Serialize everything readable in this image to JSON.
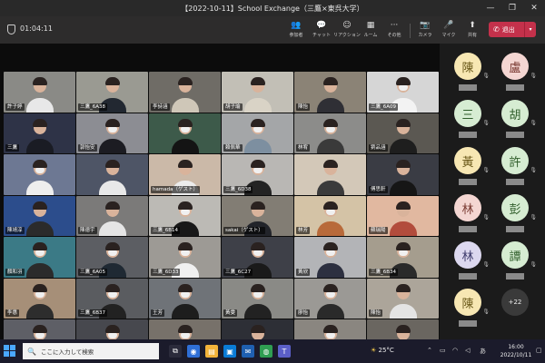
{
  "window": {
    "title": "【2022-10-11】School Exchange（三鷹×東呉大学）",
    "minimize": "—",
    "maximize": "❐",
    "close": "✕"
  },
  "toolbar": {
    "timer": "01:04:11",
    "items": [
      {
        "icon": "👥",
        "label": "参加者"
      },
      {
        "icon": "💬",
        "label": "チャット"
      },
      {
        "icon": "☺",
        "label": "リアクション"
      },
      {
        "icon": "▦",
        "label": "ルーム"
      },
      {
        "icon": "···",
        "label": "その他"
      },
      {
        "icon": "📷",
        "label": "カメラ"
      },
      {
        "icon": "🎤",
        "label": "マイク"
      },
      {
        "icon": "⬆",
        "label": "共有"
      }
    ],
    "leave_icon": "✆",
    "leave_label": "退出",
    "leave_dropdown": "▾"
  },
  "tiles": [
    {
      "name": "許子婷",
      "bg": "#8a8a86",
      "shirt": "#e8e8e8",
      "mask": false
    },
    {
      "name": "三鷹_6A38",
      "bg": "#9a9a92",
      "shirt": "#222831",
      "mask": false
    },
    {
      "name": "李詩涵",
      "bg": "#6f6c66",
      "shirt": "#cfc7b8",
      "mask": false
    },
    {
      "name": "胡子瑜",
      "bg": "#c2bfb6",
      "shirt": "#d9d3c6",
      "mask": false
    },
    {
      "name": "陳怡",
      "bg": "#8b8376",
      "shirt": "#2f2f35",
      "mask": false
    },
    {
      "name": "三鷹_6A09",
      "bg": "#d6d6d6",
      "shirt": "#f3f3f3",
      "mask": true
    },
    {
      "name": "三鷹",
      "bg": "#2e3347",
      "shirt": "#1a1c24",
      "mask": false
    },
    {
      "name": "郭怡安",
      "bg": "#8c8d93",
      "shirt": "#1c1c22",
      "mask": true
    },
    {
      "name": "",
      "bg": "#3d5a4a",
      "shirt": "#141414",
      "mask": true
    },
    {
      "name": "賴佩華",
      "bg": "#a4a6a8",
      "shirt": "#7d8fa0",
      "mask": true
    },
    {
      "name": "林宥",
      "bg": "#8c8c8a",
      "shirt": "#3a3a3a",
      "mask": true
    },
    {
      "name": "劉品涵",
      "bg": "#5b5852",
      "shirt": "#1e1e1e",
      "mask": false
    },
    {
      "name": "",
      "bg": "#6d7893",
      "shirt": "#eeeeee",
      "mask": true
    },
    {
      "name": "",
      "bg": "#4e5566",
      "shirt": "#e8e8e8",
      "mask": false
    },
    {
      "name": "hamada（ゲスト）",
      "bg": "#cbb9a8",
      "shirt": "#ececec",
      "mask": false
    },
    {
      "name": "三鷹_6D38",
      "bg": "#b9b7b4",
      "shirt": "#232323",
      "mask": true
    },
    {
      "name": "",
      "bg": "#d3c8b8",
      "shirt": "#3b3b3b",
      "mask": false
    },
    {
      "name": "傅思軒",
      "bg": "#3a3c44",
      "shirt": "#161616",
      "mask": false
    },
    {
      "name": "陳靖淳",
      "bg": "#2c4d8c",
      "shirt": "#2b2b2b",
      "mask": false
    },
    {
      "name": "陳德宇",
      "bg": "#7b7a79",
      "shirt": "#e5e5e5",
      "mask": false
    },
    {
      "name": "三鷹_6B14",
      "bg": "#bcbab5",
      "shirt": "#181818",
      "mask": true
    },
    {
      "name": "sakai（ゲスト）",
      "bg": "#827d74",
      "shirt": "#22242a",
      "mask": false
    },
    {
      "name": "林芳",
      "bg": "#d4c3a6",
      "shirt": "#b86a3a",
      "mask": true
    },
    {
      "name": "蘇瑞陽",
      "bg": "#e1b8a0",
      "shirt": "#b24c3c",
      "mask": false
    },
    {
      "name": "顏和羽",
      "bg": "#3b7a86",
      "shirt": "#2b2b2b",
      "mask": true
    },
    {
      "name": "三鷹_6A05",
      "bg": "#5c5e63",
      "shirt": "#1f2933",
      "mask": true
    },
    {
      "name": "三鷹_6D33",
      "bg": "#9d9a95",
      "shirt": "#f0f0f0",
      "mask": true
    },
    {
      "name": "三鷹_6C27",
      "bg": "#3e4048",
      "shirt": "#1a1a1a",
      "mask": true
    },
    {
      "name": "黃欣",
      "bg": "#b3b4b7",
      "shirt": "#2d3040",
      "mask": true
    },
    {
      "name": "三鷹_6B34",
      "bg": "#a59d8e",
      "shirt": "#2a2a2a",
      "mask": true
    },
    {
      "name": "李惠",
      "bg": "#a68f78",
      "shirt": "#2d2d2d",
      "mask": true
    },
    {
      "name": "三鷹_6B37",
      "bg": "#5a5c60",
      "shirt": "#222222",
      "mask": true
    },
    {
      "name": "王芳",
      "bg": "#6f7378",
      "shirt": "#1d1d1d",
      "mask": true
    },
    {
      "name": "黃雯",
      "bg": "#8a8a86",
      "shirt": "#222222",
      "mask": true
    },
    {
      "name": "廖怡",
      "bg": "#9b9995",
      "shirt": "#2a2a2a",
      "mask": true
    },
    {
      "name": "陳怡",
      "bg": "#aca59a",
      "shirt": "#e4e4e4",
      "mask": false
    },
    {
      "name": "",
      "bg": "#5e5f66",
      "shirt": "#1b1b1b",
      "mask": true
    },
    {
      "name": "",
      "bg": "#47484e",
      "shirt": "#222222",
      "mask": true
    },
    {
      "name": "",
      "bg": "#77716a",
      "shirt": "#303030",
      "mask": true
    },
    {
      "name": "",
      "bg": "#2d2f36",
      "shirt": "#111111",
      "mask": false
    },
    {
      "name": "",
      "bg": "#8a8680",
      "shirt": "#242424",
      "mask": true
    },
    {
      "name": "",
      "bg": "#6a6660",
      "shirt": "#ededed",
      "mask": false
    }
  ],
  "roster": [
    {
      "char": "陳",
      "bg": "#f7e7b3",
      "fg": "#6b5a1a"
    },
    {
      "char": "盧",
      "bg": "#f4d6d2",
      "fg": "#7a3b33"
    },
    {
      "char": "三",
      "bg": "#d6ecd2",
      "fg": "#2f5d2a"
    },
    {
      "char": "胡",
      "bg": "#d6ecd2",
      "fg": "#2f5d2a"
    },
    {
      "char": "黃",
      "bg": "#f7e7b3",
      "fg": "#6b5a1a"
    },
    {
      "char": "許",
      "bg": "#d6ecd2",
      "fg": "#2f5d2a"
    },
    {
      "char": "林",
      "bg": "#f4d6d2",
      "fg": "#7a3b33"
    },
    {
      "char": "彭",
      "bg": "#d6ecd2",
      "fg": "#2f5d2a"
    },
    {
      "char": "林",
      "bg": "#dcd8ef",
      "fg": "#3c3a6b"
    },
    {
      "char": "譚",
      "bg": "#d6ecd2",
      "fg": "#2f5d2a"
    },
    {
      "char": "陳",
      "bg": "#f7e7b3",
      "fg": "#6b5a1a"
    }
  ],
  "roster_more": "+22",
  "taskbar": {
    "search_placeholder": "ここに入力して検索",
    "search_icon": "🔍",
    "apps": [
      {
        "icon": "⧉",
        "bg": "#2b2b3b"
      },
      {
        "icon": "◉",
        "bg": "#2f6fd6"
      },
      {
        "icon": "▤",
        "bg": "#f2b33a"
      },
      {
        "icon": "▣",
        "bg": "#0a7bd6"
      },
      {
        "icon": "✉",
        "bg": "#1f5fb0"
      },
      {
        "icon": "◍",
        "bg": "#2f9e52"
      },
      {
        "icon": "T",
        "bg": "#5b5fc7"
      }
    ],
    "weather_icon": "☀",
    "temperature": "25°C",
    "ime": "あ",
    "time": "16:00",
    "date": "2022/10/11"
  }
}
